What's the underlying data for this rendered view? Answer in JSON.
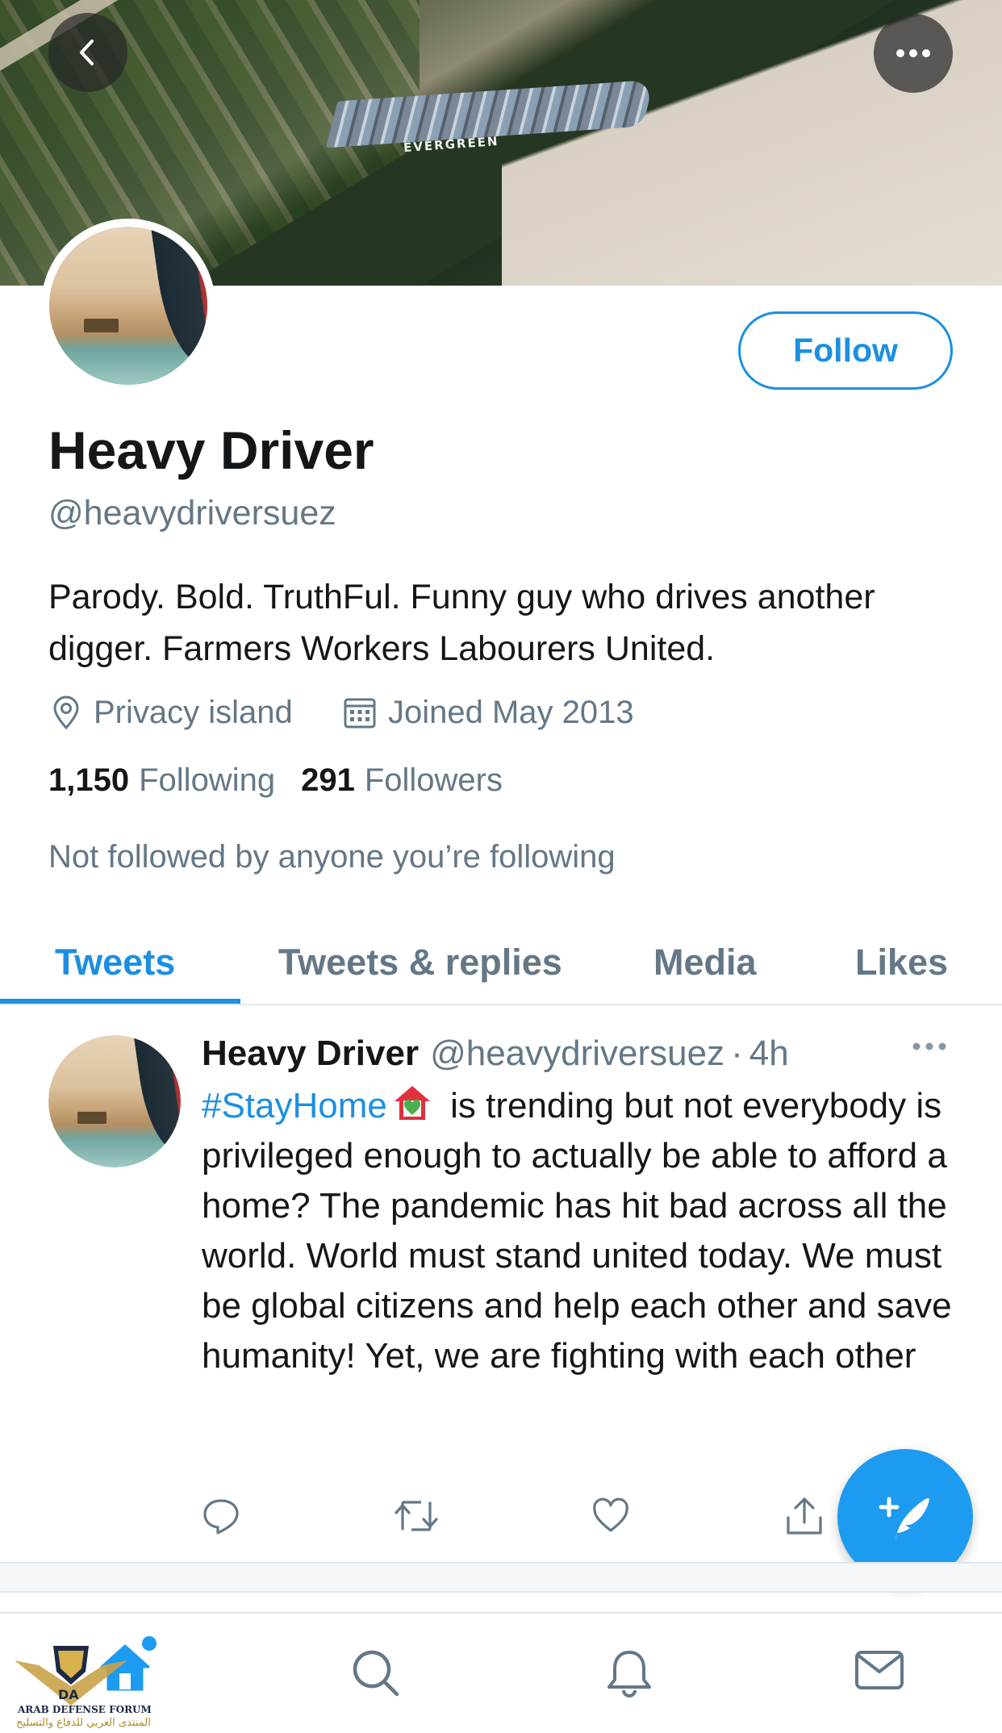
{
  "banner": {
    "ship_name": "EVERGREEN"
  },
  "profile": {
    "name": "Heavy Driver",
    "handle": "@heavydriversuez",
    "follow_label": "Follow",
    "bio": "Parody. Bold. TruthFul. Funny guy who drives another digger. Farmers Workers Labourers United.",
    "location": "Privacy island",
    "joined": "Joined May 2013",
    "following_count": "1,150",
    "following_label": "Following",
    "followers_count": "291",
    "followers_label": "Followers",
    "not_followed_text": "Not followed by anyone you’re following"
  },
  "tabs": [
    {
      "label": "Tweets",
      "active": true
    },
    {
      "label": "Tweets & replies",
      "active": false
    },
    {
      "label": "Media",
      "active": false
    },
    {
      "label": "Likes",
      "active": false
    }
  ],
  "tweet": {
    "name": "Heavy Driver",
    "handle": "@heavydriversuez",
    "separator": "·",
    "time": "4h",
    "hashtag": "#StayHome",
    "hashtag_emoji": "house-with-heart-icon",
    "text": " is trending but not everybody is privileged enough to actually be able to afford a home? The pandemic has hit bad across all the world. World must stand united today. We must be global citizens and help each other and save humanity! Yet, we are fighting with each other"
  },
  "colors": {
    "accent": "#1d8fe1",
    "secondary_text": "#657786",
    "primary_text": "#14171a",
    "fab": "#1d9bf0"
  },
  "bottom_nav": [
    "home-icon",
    "search-icon",
    "notifications-icon",
    "messages-icon"
  ],
  "watermark": {
    "line1": "ARAB DEFENSE FORUM",
    "line2": "المنتدى العربي للدفاع والتسليح",
    "logo_text": "DA"
  }
}
